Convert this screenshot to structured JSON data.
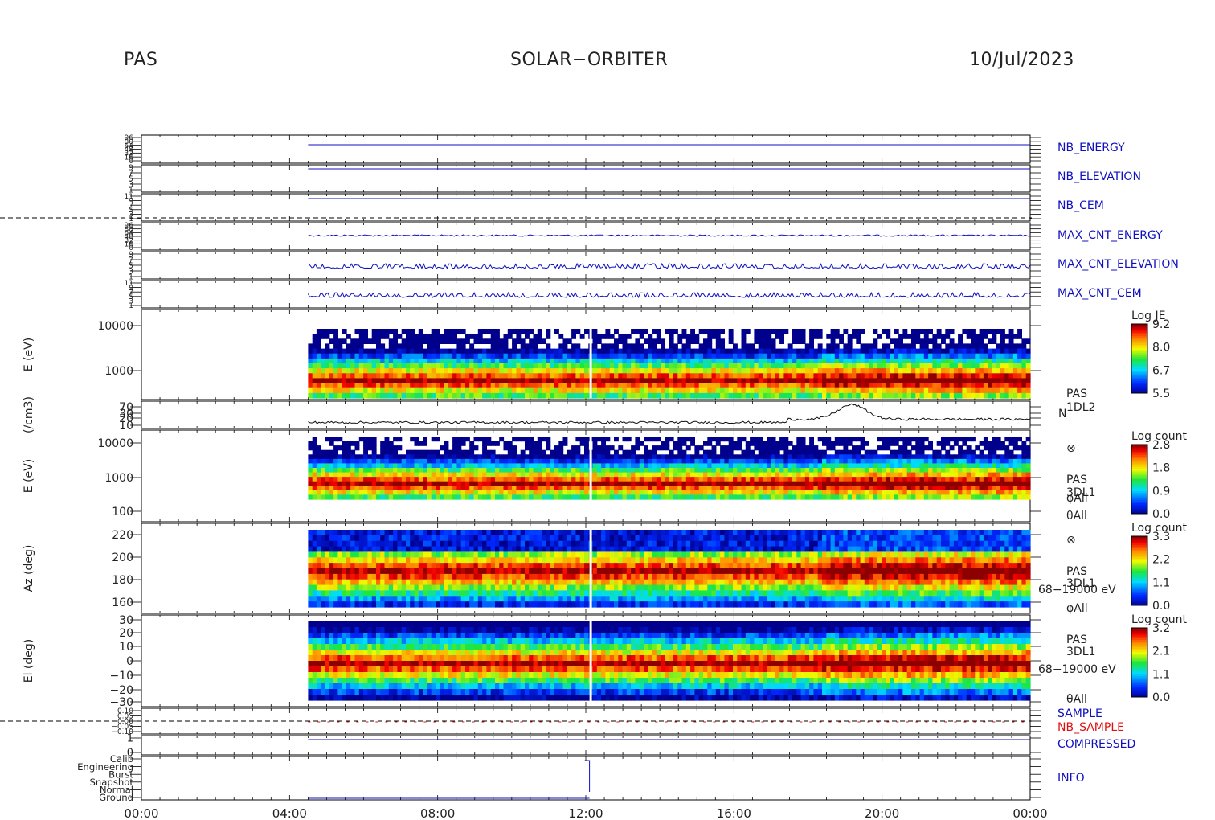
{
  "header": {
    "instrument": "PAS",
    "mission": "SOLAR−ORBITER",
    "date": "10/Jul/2023"
  },
  "colors": {
    "blue_trace": "#1010c0",
    "red_label": "#e01010",
    "axis": "#000000"
  },
  "chart_data": {
    "type": "heatmap",
    "x_ticks": [
      "00:00",
      "04:00",
      "08:00",
      "12:00",
      "16:00",
      "20:00",
      "00:00"
    ],
    "x_range_hours": [
      0,
      24
    ],
    "data_start_hour": 4.5,
    "gap_hour": 12.1,
    "panels": [
      {
        "id": "nb_energy",
        "label": "NB_ENERGY",
        "label_color": "#1010c0",
        "type": "line",
        "ticks": [
          "96",
          "80",
          "64",
          "48",
          "32",
          "16",
          "0"
        ]
      },
      {
        "id": "nb_elevation",
        "label": "NB_ELEVATION",
        "label_color": "#1010c0",
        "type": "line",
        "ticks": [
          "9",
          "7",
          "5",
          "3",
          "1"
        ]
      },
      {
        "id": "nb_cem",
        "label": "NB_CEM",
        "label_color": "#1010c0",
        "type": "line",
        "ticks": [
          "11",
          "9",
          "7",
          "5",
          "3",
          "1"
        ]
      },
      {
        "id": "max_cnt_energy",
        "label": "MAX_CNT_ENERGY",
        "label_color": "#1010c0",
        "type": "line",
        "ticks": [
          "96",
          "80",
          "64",
          "48",
          "32",
          "16",
          "0"
        ]
      },
      {
        "id": "max_cnt_elevation",
        "label": "MAX_CNT_ELEVATION",
        "label_color": "#1010c0",
        "type": "line",
        "ticks": [
          "9",
          "7",
          "5",
          "3",
          "1"
        ]
      },
      {
        "id": "max_cnt_cem",
        "label": "MAX_CNT_CEM",
        "label_color": "#1010c0",
        "type": "line",
        "ticks": [
          "11",
          "9",
          "7",
          "5",
          "3",
          "1"
        ]
      },
      {
        "id": "energy_je",
        "ylabel": "E (eV)",
        "type": "heatmap",
        "ticks": [
          "10000",
          "1000"
        ],
        "colorbar": {
          "title": "Log JE",
          "ticks": [
            "9.2",
            "8.0",
            "6.7",
            "5.5"
          ]
        }
      },
      {
        "id": "density",
        "ylabel": "(/cm3)",
        "type": "line",
        "ticks": [
          "70",
          "30",
          "20",
          "10"
        ],
        "right_label": [
          "PAS",
          "1DL2",
          "N"
        ]
      },
      {
        "id": "energy_count",
        "ylabel": "E (eV)",
        "type": "heatmap",
        "ticks": [
          "10000",
          "1000",
          "100"
        ],
        "colorbar": {
          "title": "Log count",
          "ticks": [
            "2.8",
            "1.8",
            "0.9",
            "0.0"
          ]
        },
        "right_label": [
          "⊗",
          "PAS",
          "3DL1",
          "φAll",
          "θAll"
        ]
      },
      {
        "id": "azimuth",
        "ylabel": "Az (deg)",
        "type": "heatmap",
        "ticks": [
          "220",
          "200",
          "180",
          "160"
        ],
        "colorbar": {
          "title": "Log count",
          "ticks": [
            "3.3",
            "2.2",
            "1.1",
            "0.0"
          ]
        },
        "right_label": [
          "⊗",
          "PAS",
          "3DL1",
          "68−19000 eV",
          "φAll"
        ]
      },
      {
        "id": "elevation",
        "ylabel": "El (deg)",
        "type": "heatmap",
        "ticks": [
          "30",
          "20",
          "10",
          "0",
          "−10",
          "−20",
          "−30"
        ],
        "colorbar": {
          "title": "Log count",
          "ticks": [
            "3.2",
            "2.1",
            "1.1",
            "0.0"
          ]
        },
        "right_label": [
          "PAS",
          "3DL1",
          "68−19000 eV",
          "θAll"
        ]
      },
      {
        "id": "sample",
        "label": "SAMPLE",
        "label2": "NB_SAMPLE",
        "label_color": "#1010c0",
        "label2_color": "#e01010",
        "type": "line",
        "ticks": [
          "0.10",
          "0.05",
          "0.00",
          "−0.05",
          "−0.10"
        ]
      },
      {
        "id": "compressed",
        "label": "COMPRESSED",
        "label_color": "#1010c0",
        "type": "line",
        "ticks": [
          "1",
          "0"
        ]
      },
      {
        "id": "info",
        "label": "INFO",
        "label_color": "#1010c0",
        "type": "line",
        "ticks": [
          "Calib",
          "Engineering",
          "Burst",
          "Snapshot",
          "Normal",
          "Ground"
        ]
      }
    ]
  }
}
